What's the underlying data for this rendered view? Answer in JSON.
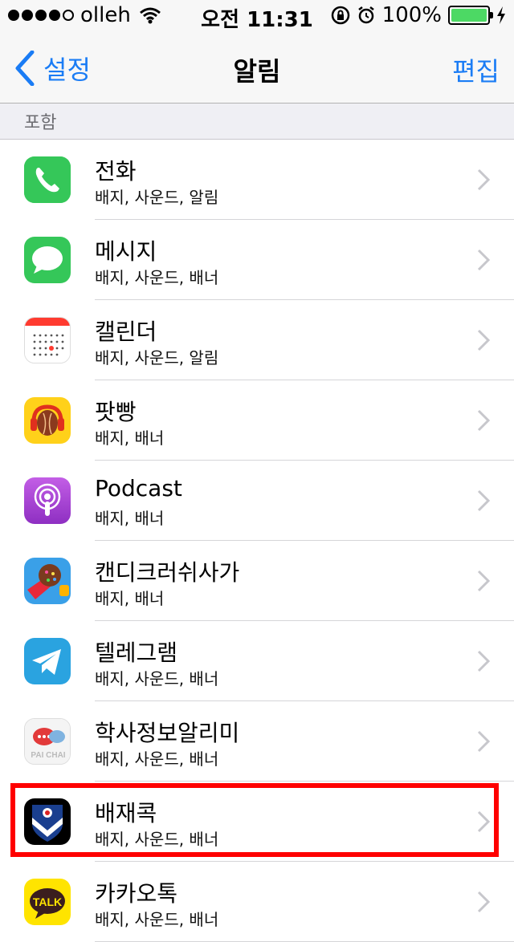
{
  "status_bar": {
    "carrier": "olleh",
    "time": "오전 11:31",
    "battery": "100%",
    "signal_bars": 4,
    "battery_level": 1.0
  },
  "nav": {
    "back_label": "설정",
    "title": "알림",
    "edit_label": "편집"
  },
  "section": {
    "header": "포함"
  },
  "apps": [
    {
      "name": "전화",
      "sub": "배지, 사운드, 알림",
      "icon": "phone-icon",
      "color": "#4cd964"
    },
    {
      "name": "메시지",
      "sub": "배지, 사운드, 배너",
      "icon": "messages-icon",
      "color": "#4cd964"
    },
    {
      "name": "캘린더",
      "sub": "배지, 사운드, 알림",
      "icon": "calendar-icon",
      "color": "#ffffff"
    },
    {
      "name": "팟빵",
      "sub": "배지, 배너",
      "icon": "podbbang-icon",
      "color": "#ffd11a"
    },
    {
      "name": "Podcast",
      "sub": "배지, 배너",
      "icon": "podcast-icon",
      "color": "#a845d8"
    },
    {
      "name": "캔디크러쉬사가",
      "sub": "배지, 배너",
      "icon": "candy-crush-icon",
      "color": "#3aa0e8"
    },
    {
      "name": "텔레그램",
      "sub": "배지, 사운드, 배너",
      "icon": "telegram-icon",
      "color": "#2aa3e0"
    },
    {
      "name": "학사정보알리미",
      "sub": "배지, 사운드, 배너",
      "icon": "paichai-notice-icon",
      "color": "#f2f2f2"
    },
    {
      "name": "배재콕",
      "sub": "배지, 사운드, 배너",
      "icon": "paichai-kok-icon",
      "color": "#0f2a5a"
    },
    {
      "name": "카카오톡",
      "sub": "배지, 사운드, 배너",
      "icon": "kakaotalk-icon",
      "color": "#ffe400"
    }
  ],
  "colors": {
    "accent": "#1a7cf5",
    "highlight": "#ff0000"
  }
}
